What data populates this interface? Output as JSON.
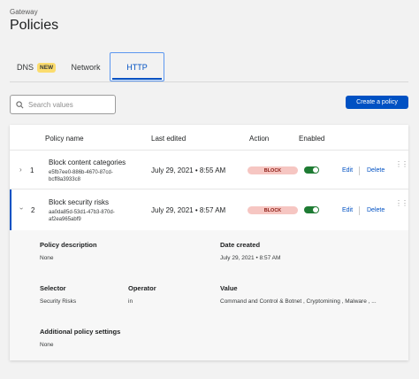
{
  "header": {
    "breadcrumb": "Gateway",
    "title": "Policies"
  },
  "tabs": [
    {
      "label": "DNS",
      "badge": "NEW"
    },
    {
      "label": "Network"
    },
    {
      "label": "HTTP",
      "active": true
    }
  ],
  "search": {
    "placeholder": "Search values",
    "value": ""
  },
  "toolbar": {
    "create_label": "Create a policy"
  },
  "table": {
    "headers": {
      "name": "Policy name",
      "edited": "Last edited",
      "action": "Action",
      "enabled": "Enabled"
    },
    "rows": [
      {
        "number": "1",
        "name": "Block content categories",
        "id_line1": "e5fb7ee0-886b-4670-87cd-",
        "id_line2": "bcff8a3933c8",
        "edited": "July 29, 2021 • 8:55 AM",
        "action": "BLOCK",
        "enabled": true,
        "edit": "Edit",
        "delete": "Delete",
        "expanded": false
      },
      {
        "number": "2",
        "name": "Block security risks",
        "id_line1": "aa0da85d-53d1-47b3-870d-",
        "id_line2": "af2ea965abf9",
        "edited": "July 29, 2021 • 8:57 AM",
        "action": "BLOCK",
        "enabled": true,
        "edit": "Edit",
        "delete": "Delete",
        "expanded": true
      }
    ]
  },
  "details": {
    "description_label": "Policy description",
    "description_value": "None",
    "created_label": "Date created",
    "created_value": "July 29, 2021 • 8:57 AM",
    "selector_label": "Selector",
    "selector_value": "Security Risks",
    "operator_label": "Operator",
    "operator_value": "in",
    "value_label": "Value",
    "value_value": "Command and Control & Botnet , Cryptomining , Malware , ...",
    "settings_label": "Additional policy settings",
    "settings_value": "None"
  },
  "colors": {
    "accent": "#0051c3",
    "block_pill": "#f6c6c2",
    "toggle_on": "#1e7b33",
    "new_badge": "#fbdc6e"
  }
}
